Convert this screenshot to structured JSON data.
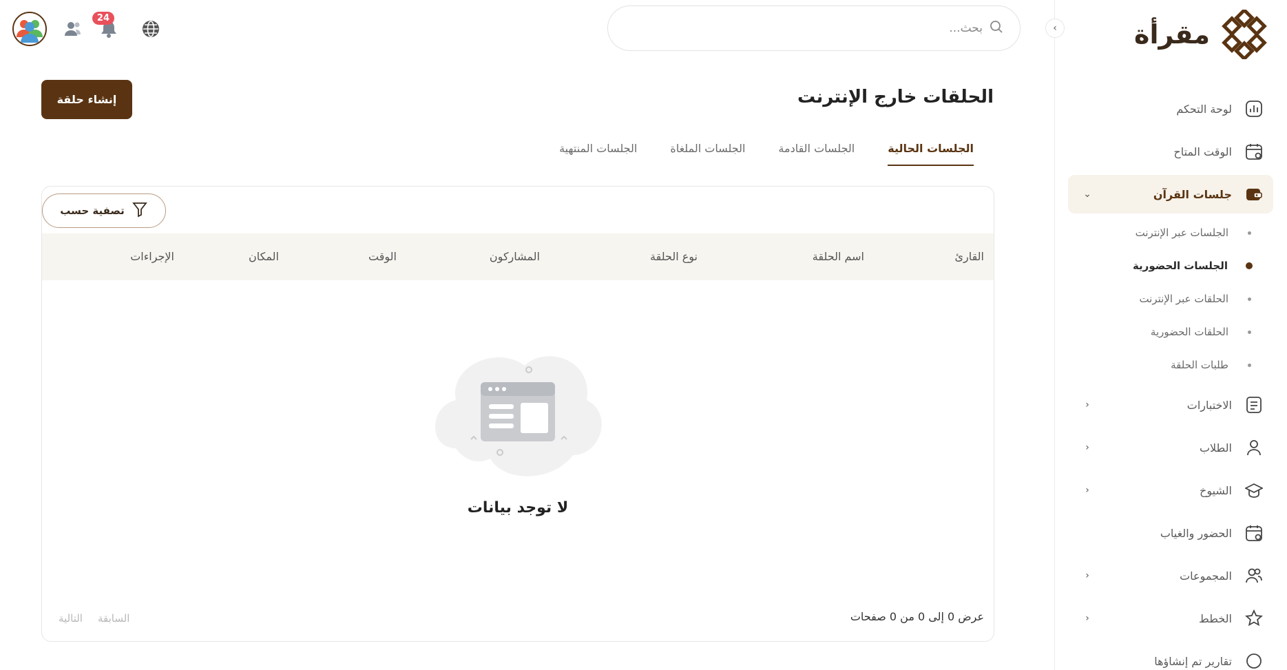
{
  "brand": {
    "name": "مقرأة"
  },
  "search": {
    "placeholder": "بحث..."
  },
  "header": {
    "notification_count": "24"
  },
  "page": {
    "title": "الحلقات خارج الإنترنت",
    "create_label": "إنشاء حلقة"
  },
  "tabs": [
    {
      "label": "الجلسات الحالية",
      "active": true
    },
    {
      "label": "الجلسات القادمة",
      "active": false
    },
    {
      "label": "الجلسات الملغاة",
      "active": false
    },
    {
      "label": "الجلسات المنتهية",
      "active": false
    }
  ],
  "filter": {
    "label": "تصفية حسب"
  },
  "table": {
    "columns": [
      "القارئ",
      "اسم الحلقة",
      "نوع الحلقة",
      "المشاركون",
      "الوقت",
      "المكان",
      "الإجراءات"
    ],
    "rows": []
  },
  "empty": {
    "text": "لا توجد بيانات"
  },
  "pagination": {
    "info": "عرض 0 إلى 0 من 0 صفحات",
    "prev_label": "السابقة",
    "next_label": "التالية"
  },
  "sidebar": {
    "items": [
      {
        "label": "لوحة التحكم",
        "icon": "dashboard-icon"
      },
      {
        "label": "الوقت المتاح",
        "icon": "calendar-icon"
      },
      {
        "label": "جلسات القرآن",
        "icon": "wallet-icon",
        "active": true,
        "expanded": true,
        "children": [
          {
            "label": "الجلسات عبر الإنترنت"
          },
          {
            "label": "الجلسات الحضورية",
            "active": true
          },
          {
            "label": "الحلقات عبر الإنترنت"
          },
          {
            "label": "الحلقات الحضورية"
          },
          {
            "label": "طلبات الحلقة"
          }
        ]
      },
      {
        "label": "الاختبارات",
        "icon": "document-icon",
        "has_children": true
      },
      {
        "label": "الطلاب",
        "icon": "user-icon",
        "has_children": true
      },
      {
        "label": "الشيوخ",
        "icon": "graduation-cap-icon",
        "has_children": true
      },
      {
        "label": "الحضور والغياب",
        "icon": "calendar-check-icon"
      },
      {
        "label": "المجموعات",
        "icon": "users-icon",
        "has_children": true
      },
      {
        "label": "الخطط",
        "icon": "star-icon",
        "has_children": true
      },
      {
        "label": "تقارير تم إنشاؤها",
        "icon": "report-icon"
      }
    ]
  },
  "colors": {
    "brand": "#5a3412",
    "badge": "#e8505b",
    "table_header_bg": "#f6f5f0",
    "active_item_bg": "#f7f2ea"
  }
}
